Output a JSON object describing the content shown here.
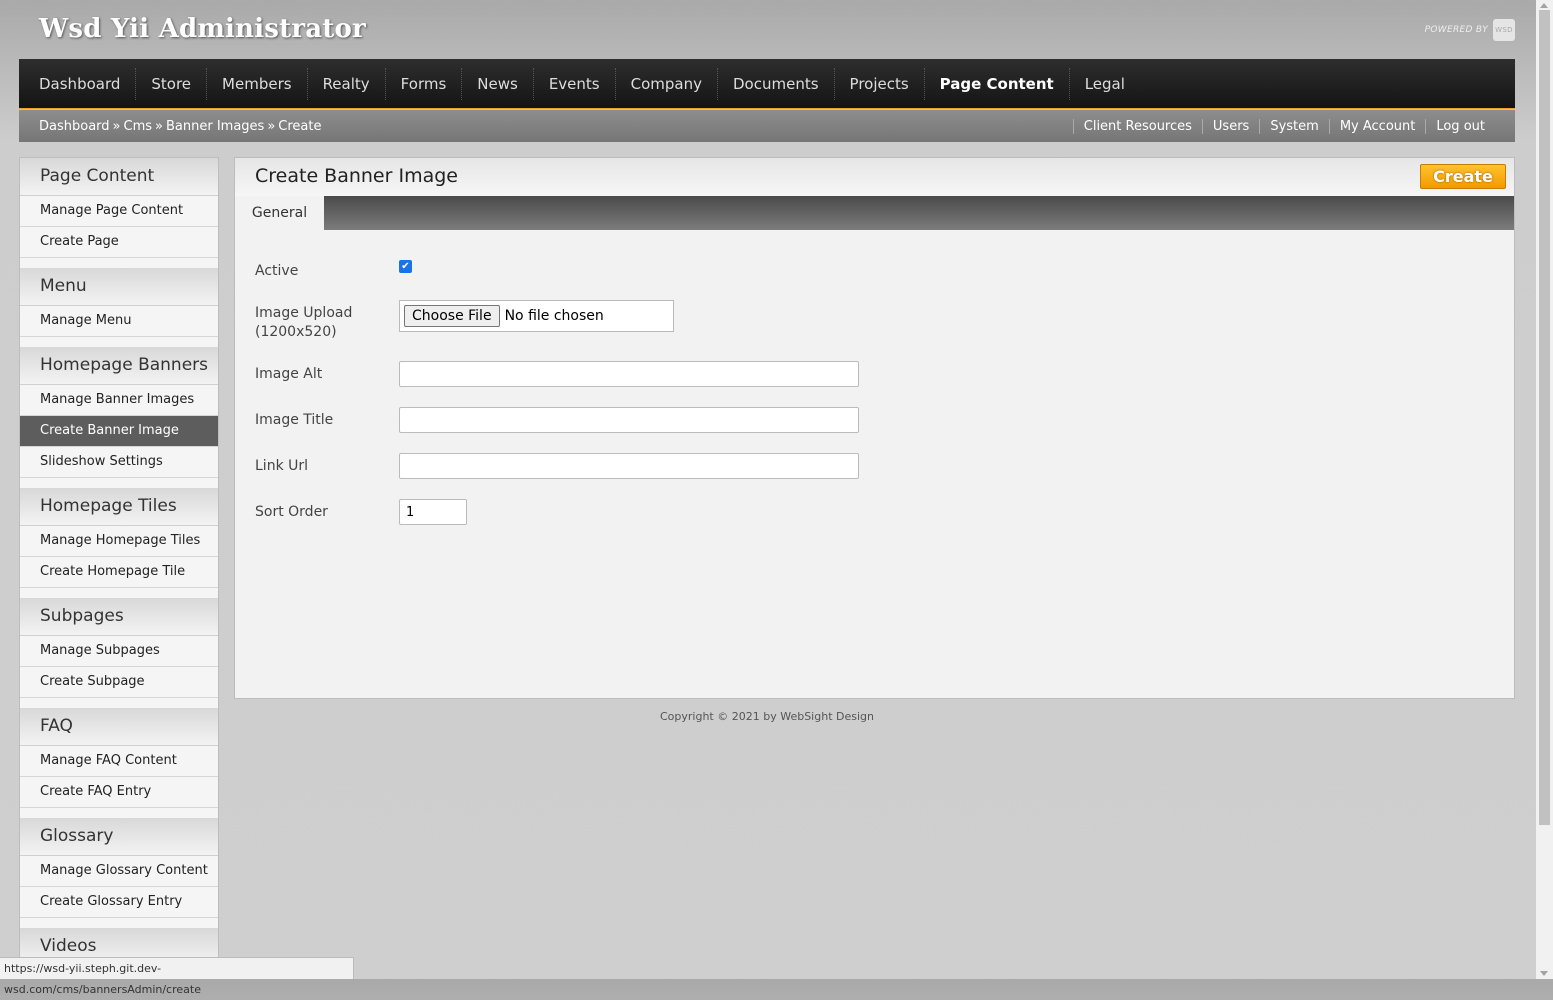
{
  "app_title": "Wsd Yii Administrator",
  "powered_by": "POWERED BY",
  "powered_logo": "WSD",
  "topnav": [
    "Dashboard",
    "Store",
    "Members",
    "Realty",
    "Forms",
    "News",
    "Events",
    "Company",
    "Documents",
    "Projects",
    "Page Content",
    "Legal"
  ],
  "topnav_active": "Page Content",
  "breadcrumb": [
    "Dashboard",
    "Cms",
    "Banner Images",
    "Create"
  ],
  "breadcrumb_sep": "»",
  "user_links": [
    "Client Resources",
    "Users",
    "System",
    "My Account",
    "Log out"
  ],
  "sidebar": [
    {
      "title": "Page Content",
      "items": [
        "Manage Page Content",
        "Create Page"
      ]
    },
    {
      "title": "Menu",
      "items": [
        "Manage Menu"
      ]
    },
    {
      "title": "Homepage Banners",
      "items": [
        "Manage Banner Images",
        "Create Banner Image",
        "Slideshow Settings"
      ]
    },
    {
      "title": "Homepage Tiles",
      "items": [
        "Manage Homepage Tiles",
        "Create Homepage Tile"
      ]
    },
    {
      "title": "Subpages",
      "items": [
        "Manage Subpages",
        "Create Subpage"
      ]
    },
    {
      "title": "FAQ",
      "items": [
        "Manage FAQ Content",
        "Create FAQ Entry"
      ]
    },
    {
      "title": "Glossary",
      "items": [
        "Manage Glossary Content",
        "Create Glossary Entry"
      ]
    },
    {
      "title": "Videos",
      "items": []
    }
  ],
  "sidebar_active": "Create Banner Image",
  "main": {
    "title": "Create Banner Image",
    "create_label": "Create",
    "tab_general": "General",
    "fields": {
      "active_label": "Active",
      "active_checked": true,
      "upload_label": "Image Upload",
      "upload_hint": "(1200x520)",
      "choose_file": "Choose File",
      "no_file": "No file chosen",
      "alt_label": "Image Alt",
      "alt_value": "",
      "title_label": "Image Title",
      "title_value": "",
      "link_label": "Link Url",
      "link_value": "",
      "sort_label": "Sort Order",
      "sort_value": "1"
    }
  },
  "footer": "Copyright © 2021 by WebSight Design",
  "status_url": "https://wsd-yii.steph.git.dev-wsd.com/cms/bannersAdmin/create"
}
